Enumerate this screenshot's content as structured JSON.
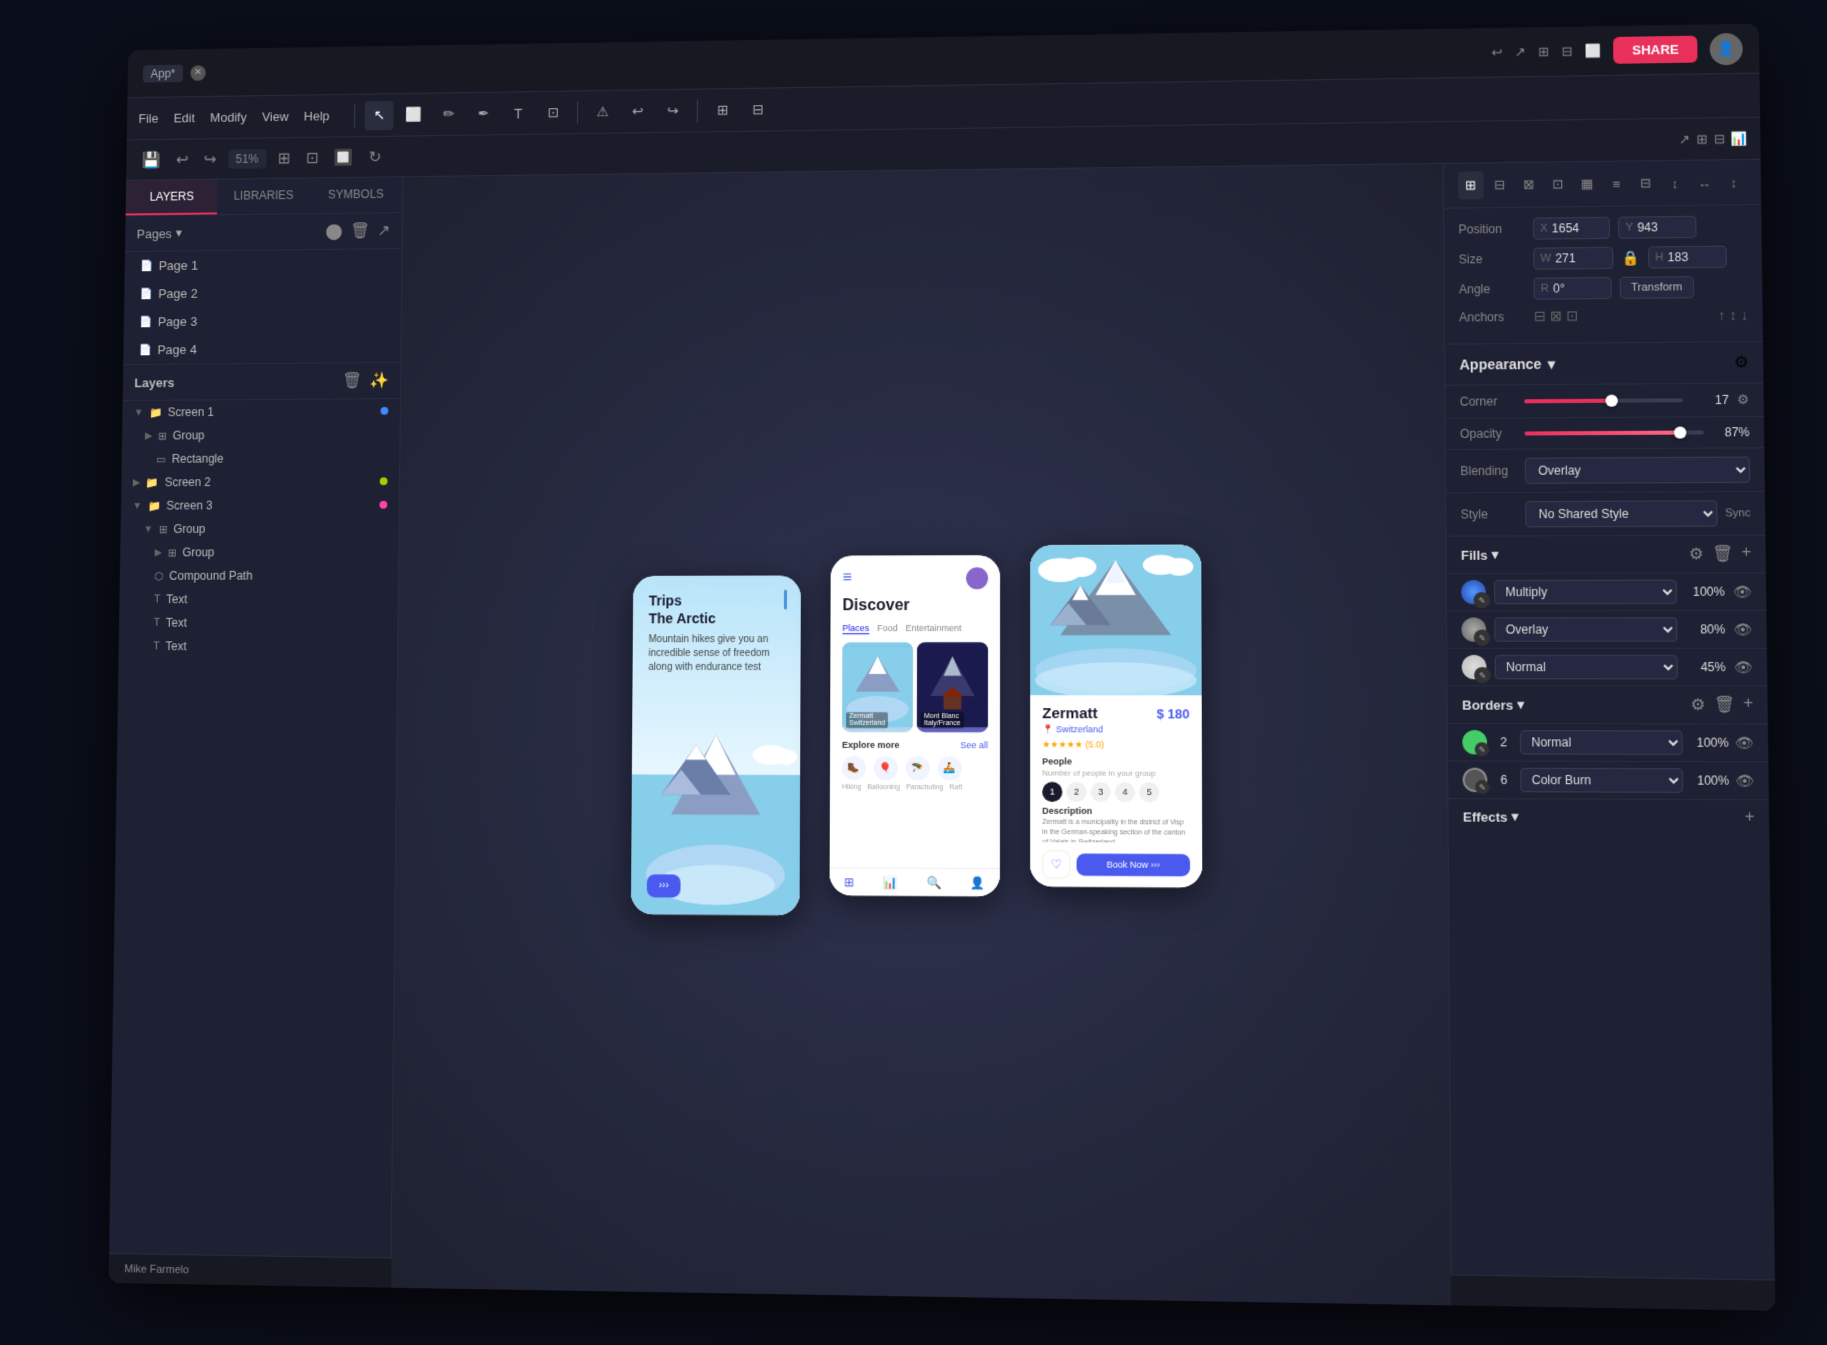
{
  "topbar": {
    "app_label": "App*",
    "share_label": "SHARE"
  },
  "menu": {
    "file": "File",
    "edit": "Edit",
    "modify": "Modify",
    "view": "View",
    "help": "Help"
  },
  "left_panel": {
    "tabs": [
      {
        "id": "layers",
        "label": "LAYERS",
        "active": true
      },
      {
        "id": "libraries",
        "label": "LIBRARIES",
        "active": false
      },
      {
        "id": "symbols",
        "label": "SYMBOLS",
        "active": false
      }
    ],
    "pages_label": "Pages",
    "pages": [
      {
        "id": "page1",
        "label": "Page 1"
      },
      {
        "id": "page2",
        "label": "Page 2"
      },
      {
        "id": "page3",
        "label": "Page 3"
      },
      {
        "id": "page4",
        "label": "Page 4"
      }
    ],
    "layers_label": "Layers",
    "layers": [
      {
        "id": "screen1",
        "label": "Screen 1",
        "type": "folder",
        "indent": 0,
        "color": "#4488ff",
        "expanded": true
      },
      {
        "id": "group1",
        "label": "Group",
        "type": "group",
        "indent": 1,
        "expanded": true
      },
      {
        "id": "rect1",
        "label": "Rectangle",
        "type": "rect",
        "indent": 2
      },
      {
        "id": "screen2",
        "label": "Screen 2",
        "type": "folder",
        "indent": 0,
        "color": "#aacc00",
        "expanded": false
      },
      {
        "id": "screen3",
        "label": "Screen 3",
        "type": "folder",
        "indent": 0,
        "color": "#ff44aa",
        "expanded": true
      },
      {
        "id": "group2",
        "label": "Group",
        "type": "group",
        "indent": 1,
        "expanded": true
      },
      {
        "id": "group3",
        "label": "Group",
        "type": "group",
        "indent": 2,
        "expanded": false
      },
      {
        "id": "compound",
        "label": "Compound Path",
        "type": "path",
        "indent": 2
      },
      {
        "id": "text1",
        "label": "Text",
        "type": "text",
        "indent": 2
      },
      {
        "id": "text2",
        "label": "Text",
        "type": "text",
        "indent": 2
      },
      {
        "id": "text3",
        "label": "Text",
        "type": "text",
        "indent": 2
      }
    ]
  },
  "right_panel": {
    "position_label": "Position",
    "position_x": "1654",
    "position_y": "943",
    "size_label": "Size",
    "size_w": "271",
    "size_h": "183",
    "angle_label": "Angle",
    "angle_r": "0°",
    "anchors_label": "Anchors",
    "transform_label": "Transform",
    "appearance_label": "Appearance",
    "corner_label": "Corner",
    "corner_val": "17",
    "corner_pct": 55,
    "opacity_label": "Opacity",
    "opacity_val": "87%",
    "opacity_pct": 87,
    "blending_label": "Blending",
    "blending_val": "Overlay",
    "style_label": "Style",
    "style_val": "No Shared Style",
    "sync_label": "Sync",
    "fills_label": "Fills",
    "fills": [
      {
        "type": "Multiply",
        "opacity": "100%",
        "color": "blue_gradient",
        "visible": true
      },
      {
        "type": "Overlay",
        "opacity": "80%",
        "color": "gray_gradient",
        "visible": true
      },
      {
        "type": "Normal",
        "opacity": "45%",
        "color": "light_gradient",
        "visible": true
      }
    ],
    "borders_label": "Borders",
    "borders": [
      {
        "type": "Normal",
        "opacity": "100%",
        "num": "2",
        "color": "green",
        "visible": true
      },
      {
        "type": "Color Burn",
        "opacity": "100%",
        "num": "6",
        "color": "dark",
        "visible": true
      }
    ],
    "effects_label": "Effects"
  },
  "phone1": {
    "title": "Trips",
    "subtitle": "The Arctic",
    "description": "Mountain hikes give you an incredible sense of freedom along with endurance test",
    "btn_label": "›››"
  },
  "phone2": {
    "title": "Discover",
    "tabs": [
      "Places",
      "Food",
      "Entertainment"
    ],
    "explore_label": "Explore more",
    "see_all": "See all",
    "activities": [
      "🥾",
      "🎈",
      "🪂",
      "⛵"
    ]
  },
  "phone3": {
    "name": "Zermatt",
    "location": "Switzerland",
    "price": "$ 180",
    "rating": "★★★★★ (5.0)",
    "people_label": "People",
    "people_sub": "Number of people in your group",
    "numbers": [
      "1",
      "2",
      "3",
      "4",
      "5"
    ],
    "desc_label": "Description",
    "description": "Zermatt is a municipality in the district of Visp in the German-speaking section of the canton of Valais in Switzerland.",
    "book_label": "Book Now  ›››"
  },
  "status_bar": {
    "user_label": "Mike Farmelo",
    "zoom_label": "51%"
  }
}
